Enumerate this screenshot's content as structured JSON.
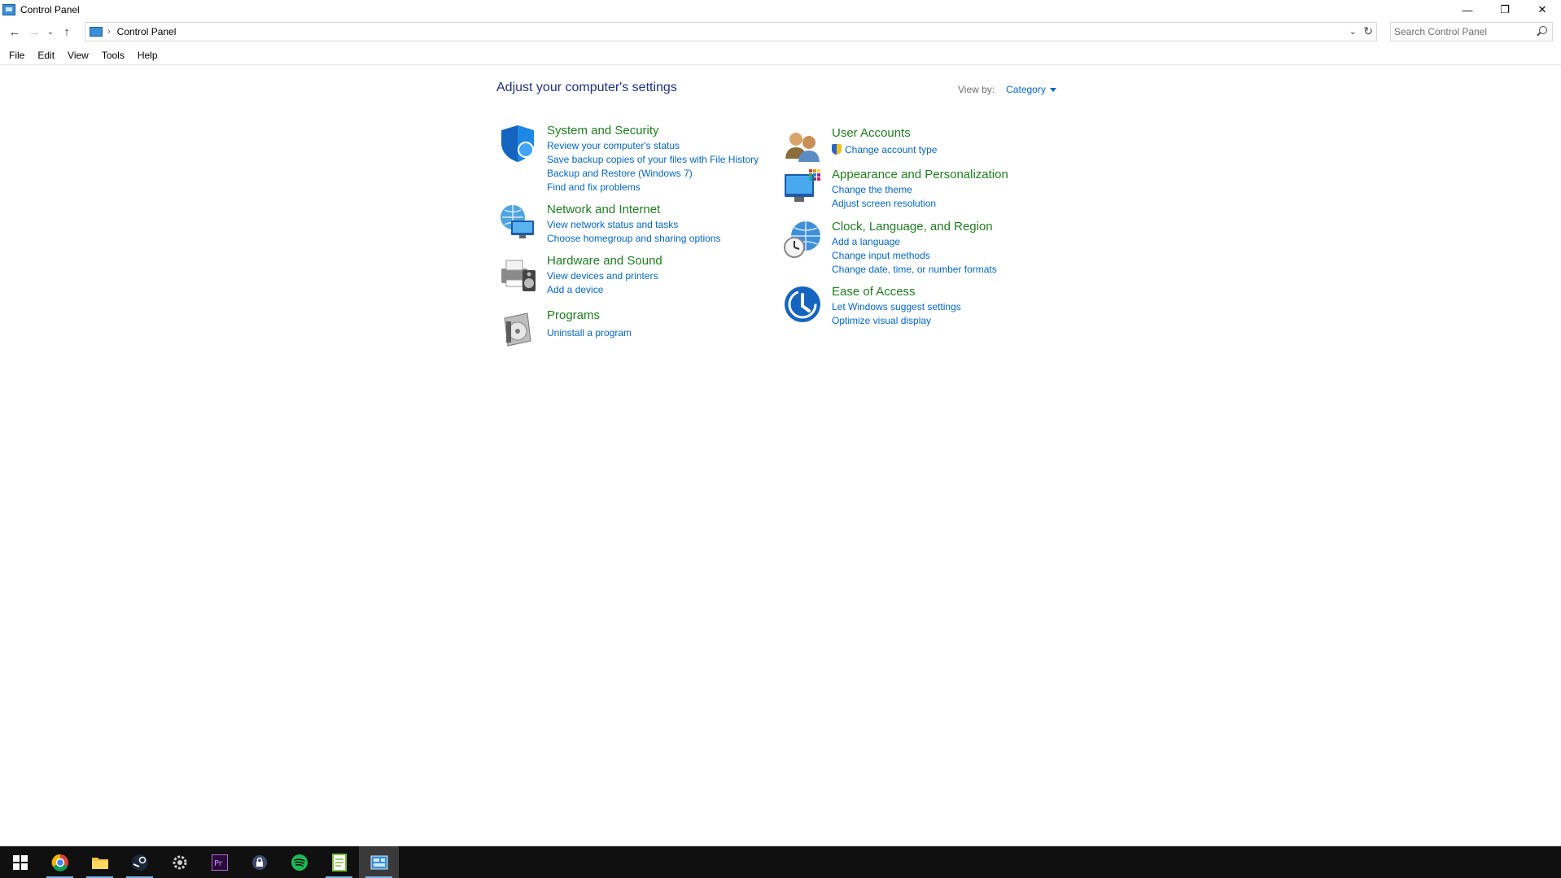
{
  "window": {
    "title": "Control Panel",
    "controls": {
      "minimize": "—",
      "restore": "❐",
      "close": "✕"
    }
  },
  "nav": {
    "back": "←",
    "forward": "→",
    "recent": "⌄",
    "up": "↑",
    "breadcrumb_separator": "›",
    "address": "Control Panel",
    "address_dropdown": "⌄",
    "refresh": "↻",
    "search_placeholder": "Search Control Panel"
  },
  "menu": [
    "File",
    "Edit",
    "View",
    "Tools",
    "Help"
  ],
  "main": {
    "heading": "Adjust your computer's settings",
    "view_by_label": "View by:",
    "view_by_value": "Category"
  },
  "categories_left": [
    {
      "title": "System and Security",
      "icon": "shield-icon",
      "links": [
        "Review your computer's status",
        "Save backup copies of your files with File History",
        "Backup and Restore (Windows 7)",
        "Find and fix problems"
      ]
    },
    {
      "title": "Network and Internet",
      "icon": "network-globe-icon",
      "links": [
        "View network status and tasks",
        "Choose homegroup and sharing options"
      ]
    },
    {
      "title": "Hardware and Sound",
      "icon": "printer-speaker-icon",
      "links": [
        "View devices and printers",
        "Add a device"
      ]
    },
    {
      "title": "Programs",
      "icon": "programs-disc-icon",
      "links": [
        "Uninstall a program"
      ]
    }
  ],
  "categories_right": [
    {
      "title": "User Accounts",
      "icon": "users-icon",
      "links": [
        "Change account type"
      ]
    },
    {
      "title": "Appearance and Personalization",
      "icon": "monitor-palette-icon",
      "links": [
        "Change the theme",
        "Adjust screen resolution"
      ]
    },
    {
      "title": "Clock, Language, and Region",
      "icon": "clock-globe-icon",
      "links": [
        "Add a language",
        "Change input methods",
        "Change date, time, or number formats"
      ]
    },
    {
      "title": "Ease of Access",
      "icon": "ease-of-access-icon",
      "links": [
        "Let Windows suggest settings",
        "Optimize visual display"
      ]
    }
  ],
  "taskbar": [
    "start-icon",
    "chrome-icon",
    "file-explorer-icon",
    "steam-icon",
    "settings-icon",
    "premiere-icon",
    "lock-app-icon",
    "spotify-icon",
    "notepad-icon",
    "control-panel-icon"
  ]
}
